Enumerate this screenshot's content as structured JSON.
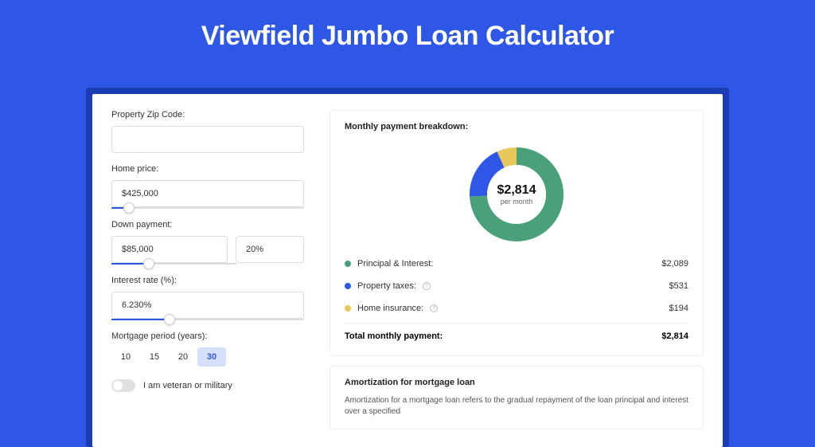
{
  "title": "Viewfield Jumbo Loan Calculator",
  "inputs": {
    "zip_label": "Property Zip Code:",
    "zip_value": "",
    "home_price_label": "Home price:",
    "home_price_value": "$425,000",
    "down_payment_label": "Down payment:",
    "down_payment_value": "$85,000",
    "down_payment_pct": "20%",
    "interest_label": "Interest rate (%):",
    "interest_value": "6.230%",
    "period_label": "Mortgage period (years):",
    "periods": [
      "10",
      "15",
      "20",
      "30"
    ],
    "period_active_index": 3,
    "veteran_label": "I am veteran or military"
  },
  "breakdown": {
    "heading": "Monthly payment breakdown:",
    "center_value": "$2,814",
    "center_sub": "per month",
    "items": [
      {
        "label": "Principal & Interest:",
        "value": "$2,089",
        "info": false
      },
      {
        "label": "Property taxes:",
        "value": "$531",
        "info": true
      },
      {
        "label": "Home insurance:",
        "value": "$194",
        "info": true
      }
    ],
    "total_label": "Total monthly payment:",
    "total_value": "$2,814"
  },
  "amort": {
    "heading": "Amortization for mortgage loan",
    "text": "Amortization for a mortgage loan refers to the gradual repayment of the loan principal and interest over a specified"
  },
  "colors": {
    "principal": "#49a079",
    "taxes": "#2e57e6",
    "insurance": "#e8c85a"
  },
  "chart_data": {
    "type": "pie",
    "title": "Monthly payment breakdown",
    "series": [
      {
        "name": "Principal & Interest",
        "value": 2089,
        "color": "#49a079"
      },
      {
        "name": "Property taxes",
        "value": 531,
        "color": "#2e57e6"
      },
      {
        "name": "Home insurance",
        "value": 194,
        "color": "#e8c85a"
      }
    ],
    "total": 2814,
    "center_label": "$2,814 per month"
  }
}
